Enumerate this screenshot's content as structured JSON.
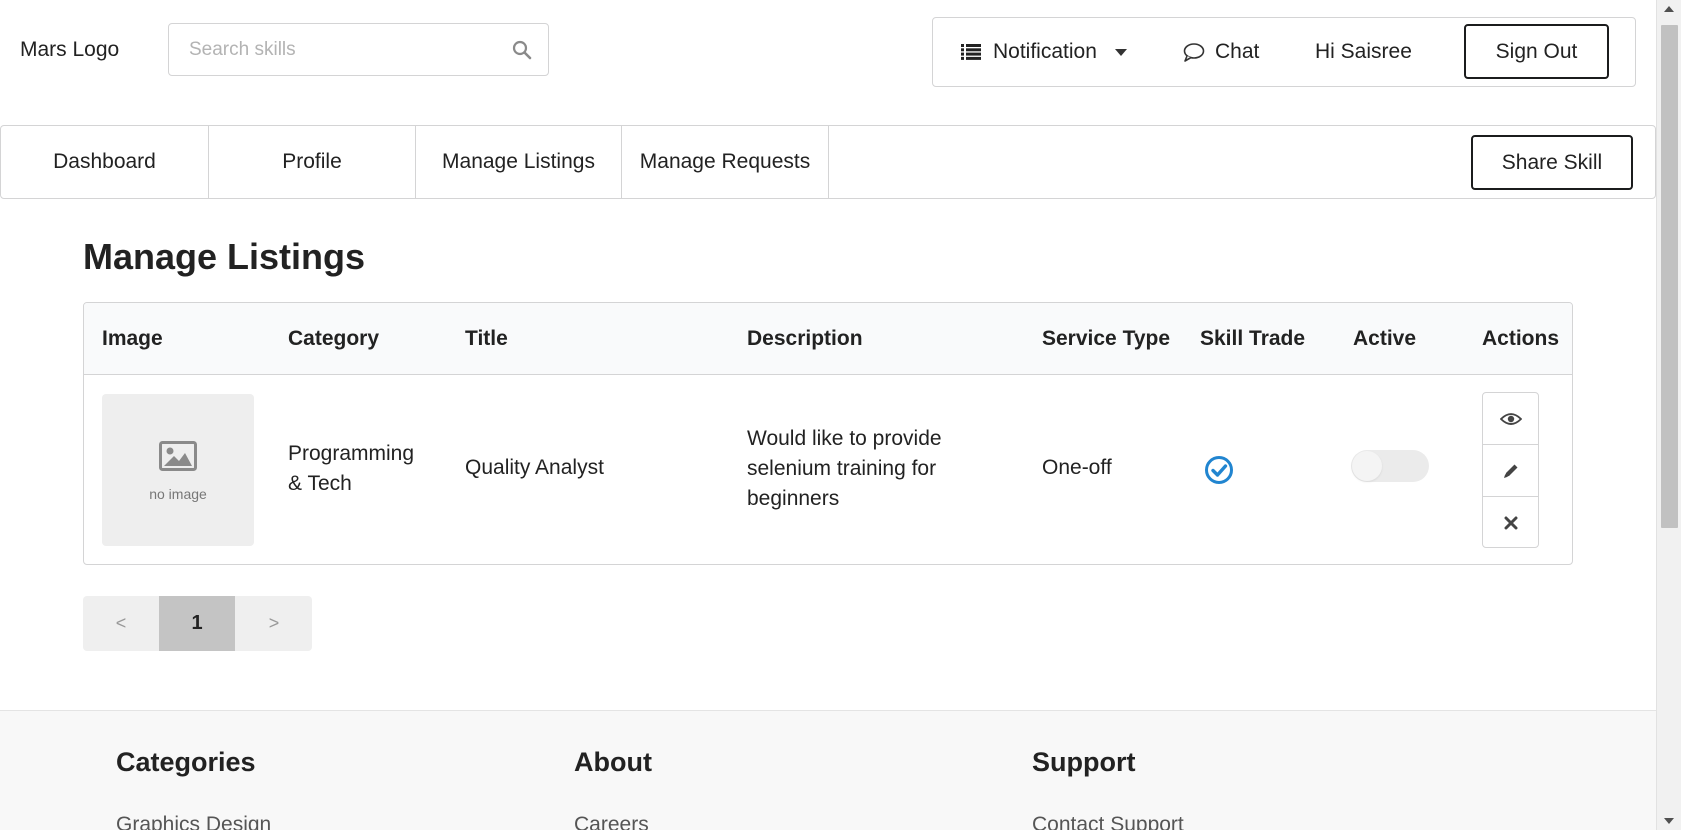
{
  "header": {
    "logo": "Mars Logo",
    "search_placeholder": "Search skills",
    "search_icon": "search-icon",
    "notification_label": "Notification",
    "chat_label": "Chat",
    "greeting": "Hi Saisree",
    "signout_label": "Sign Out"
  },
  "nav": {
    "tabs": [
      {
        "label": "Dashboard"
      },
      {
        "label": "Profile"
      },
      {
        "label": "Manage Listings"
      },
      {
        "label": "Manage Requests"
      }
    ],
    "share_label": "Share Skill"
  },
  "main": {
    "title": "Manage Listings",
    "columns": [
      "Image",
      "Category",
      "Title",
      "Description",
      "Service Type",
      "Skill Trade",
      "Active",
      "Actions"
    ],
    "rows": [
      {
        "image_caption": "no image",
        "category_line1": "Programming",
        "category_line2": "& Tech",
        "title": "Quality Analyst",
        "description_line1": "Would like to provide",
        "description_line2": "selenium training for",
        "description_line3": "beginners",
        "service_type": "One-off",
        "skill_trade_icon": "check-circle-icon",
        "active": false,
        "actions": [
          "eye-icon",
          "pencil-icon",
          "close-icon"
        ]
      }
    ]
  },
  "pagination": {
    "prev": "<",
    "current": "1",
    "next": ">"
  },
  "footer": {
    "columns": [
      {
        "heading": "Categories",
        "first_link": "Graphics Design"
      },
      {
        "heading": "About",
        "first_link": "Careers"
      },
      {
        "heading": "Support",
        "first_link": "Contact Support"
      }
    ]
  },
  "colors": {
    "accent_blue": "#2185d0",
    "border": "#d4d4d5",
    "header_bg": "#f9fafb",
    "pager_active": "#c4c4c4",
    "footer_bg": "#f8f8f8"
  }
}
